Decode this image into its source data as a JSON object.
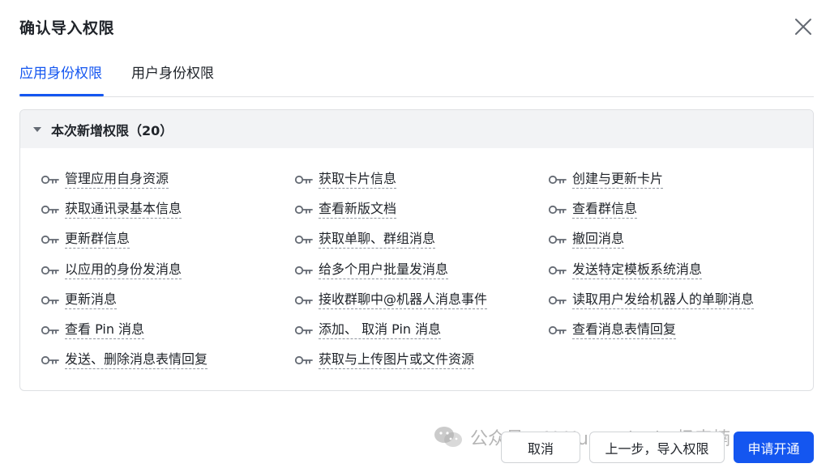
{
  "dialog": {
    "title": "确认导入权限",
    "close_icon": "close-icon"
  },
  "tabs": [
    {
      "label": "应用身份权限",
      "active": true
    },
    {
      "label": "用户身份权限",
      "active": false
    }
  ],
  "section": {
    "title": "本次新增权限（20）",
    "expanded": true
  },
  "permissions": [
    "管理应用自身资源",
    "获取卡片信息",
    "创建与更新卡片",
    "获取通讯录基本信息",
    "查看新版文档",
    "查看群信息",
    "更新群信息",
    "获取单聊、群组消息",
    "撤回消息",
    "以应用的身份发消息",
    "给多个用户批量发消息",
    "发送特定模板系统消息",
    "更新消息",
    "接收群聊中@机器人消息事件",
    "读取用户发给机器人的单聊消息",
    "查看 Pin 消息",
    "添加、 取消 Pin 消息",
    "查看消息表情回复",
    "发送、删除消息表情回复",
    "获取与上传图片或文件资源"
  ],
  "footer": {
    "cancel_label": "取消",
    "prev_label": "上一步，导入权限",
    "apply_label": "申请开通"
  },
  "watermark": "公众号 · AI Humanist by杨森楠",
  "colors": {
    "accent": "#1456f0",
    "section_bg": "#f2f3f5",
    "border": "#dee0e3",
    "text": "#1f2329"
  }
}
